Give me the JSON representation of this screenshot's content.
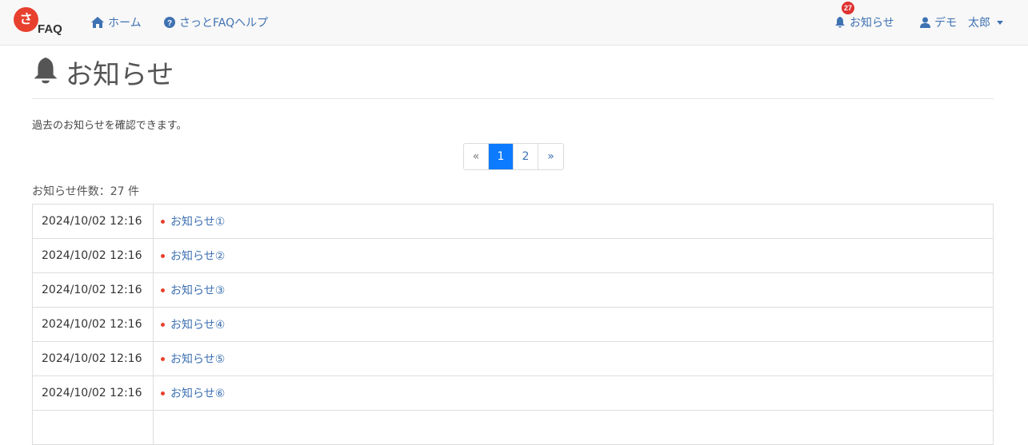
{
  "nav": {
    "logo_text": "さ",
    "logo_sub": "FAQ",
    "home_label": "ホーム",
    "help_label": "さっとFAQヘルプ",
    "notice_label": "お知らせ",
    "notice_badge": "27",
    "user_label": "デモ　太郎"
  },
  "page": {
    "title": "お知らせ",
    "description": "過去のお知らせを確認できます。",
    "count_text": "お知らせ件数：27 件"
  },
  "pagination": {
    "prev": "«",
    "pages": [
      "1",
      "2"
    ],
    "active": "1",
    "next": "»"
  },
  "notices": [
    {
      "date": "2024/10/02 12:16",
      "title": "お知らせ①"
    },
    {
      "date": "2024/10/02 12:16",
      "title": "お知らせ②"
    },
    {
      "date": "2024/10/02 12:16",
      "title": "お知らせ③"
    },
    {
      "date": "2024/10/02 12:16",
      "title": "お知らせ④"
    },
    {
      "date": "2024/10/02 12:16",
      "title": "お知らせ⑤"
    },
    {
      "date": "2024/10/02 12:16",
      "title": "お知らせ⑥"
    },
    {
      "date": "",
      "title": ""
    }
  ],
  "colors": {
    "link": "#3f72b3",
    "active_page": "#0d7bff",
    "badge": "#e03131",
    "brand": "#e8402e"
  },
  "icons": {
    "home": "home-icon",
    "help": "question-circle-icon",
    "notice": "bell-icon",
    "user": "user-icon"
  }
}
